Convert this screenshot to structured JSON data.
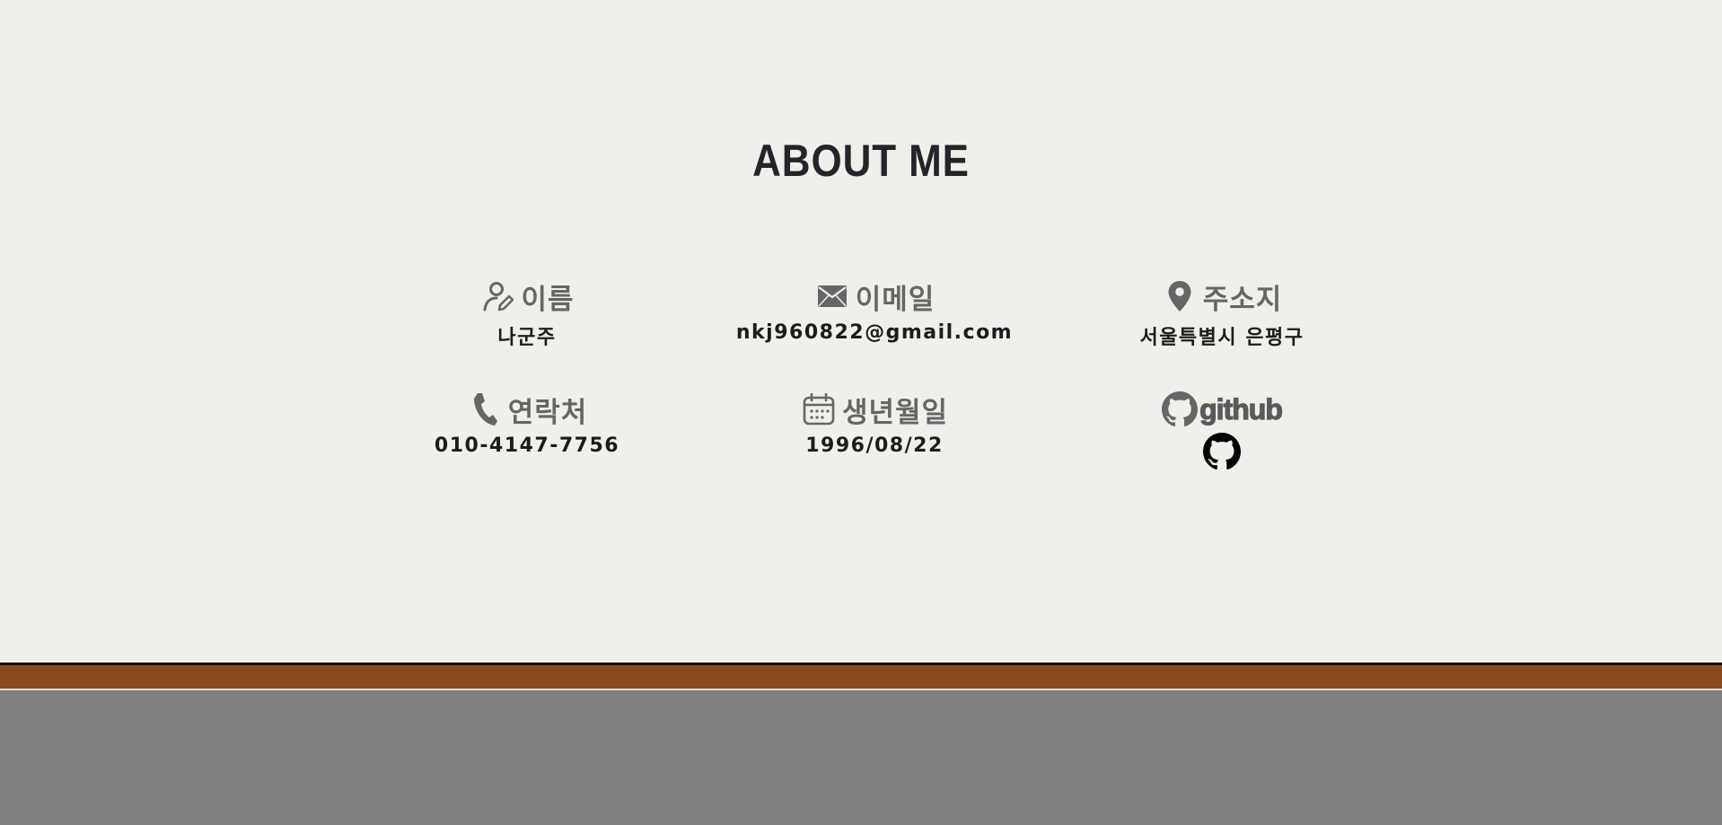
{
  "section": {
    "title": "ABOUT ME"
  },
  "info": {
    "name": {
      "icon": "user-pen-icon",
      "label": "이름",
      "value": "나군주"
    },
    "email": {
      "icon": "envelope-icon",
      "label": "이메일",
      "value": "nkj960822@gmail.com"
    },
    "address": {
      "icon": "map-pin-icon",
      "label": "주소지",
      "value": "서울특별시 은평구"
    },
    "phone": {
      "icon": "phone-icon",
      "label": "연락처",
      "value": "010-4147-7756"
    },
    "birthday": {
      "icon": "calendar-icon",
      "label": "생년월일",
      "value": "1996/08/22"
    },
    "github": {
      "icon": "github-icon",
      "label": "github",
      "link_icon": "github-icon"
    }
  },
  "colors": {
    "background": "#f0efea",
    "title": "#222529",
    "label": "#666666",
    "value": "#1c1c1c",
    "footer_stripe": "#8b4a1e",
    "footer": "#808080"
  }
}
